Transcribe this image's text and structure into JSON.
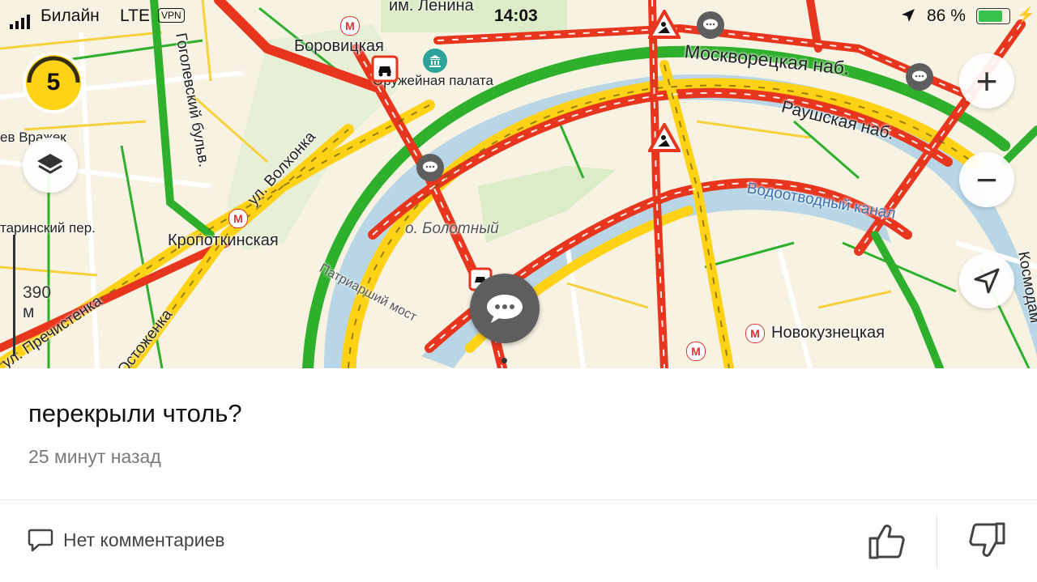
{
  "status_bar": {
    "carrier": "Билайн",
    "network": "LTE",
    "vpn": "VPN",
    "time": "14:03",
    "battery_percent": "86 %",
    "battery_level": 0.86
  },
  "map": {
    "traffic_level": "5",
    "scale_label": "390 м",
    "labels": {
      "borovitskaya": "Боровицкая",
      "lenin": "им. Ленина",
      "armory": "Оружейная палата",
      "moskvoretskaya": "Москворецкая наб.",
      "raushskaya": "Раушская наб.",
      "vodootvodny": "Водоотводный канал",
      "volkhonka": "ул. Волхонка",
      "gogolevsky": "Гоголевский бульв.",
      "kropotkinskaya": "Кропоткинская",
      "bolotny": "о. Болотный",
      "patriarchy": "Патриарший мост",
      "prechistenka": "ул. Пречистенка",
      "ostozhenka": "Остоженка",
      "novokuznetskaya": "Новокузнецкая",
      "vrazhek": "ев Вражек",
      "tarinsky": "таринский пер.",
      "kosmodamianskaya": "Космодам"
    },
    "colors": {
      "jam": "#e8361e",
      "slow": "#ffd215",
      "free": "#2fb02c",
      "water": "#b8d6e6",
      "park": "#dcebc8"
    }
  },
  "controls": {
    "zoom_in": "+",
    "zoom_out": "−"
  },
  "comment": {
    "text": "перекрыли чтоль?",
    "time": "25 минут назад",
    "comments_label": "Нет комментариев"
  }
}
